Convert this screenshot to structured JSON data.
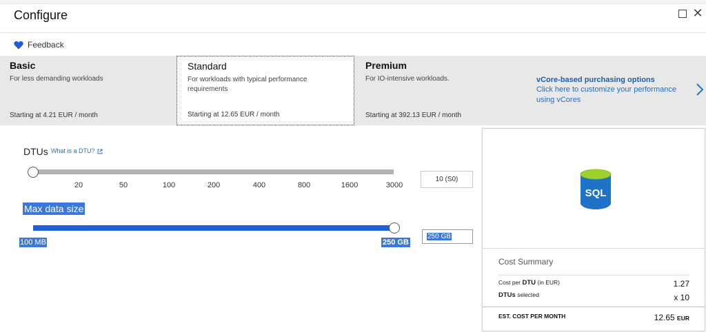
{
  "window": {
    "title": "Configure"
  },
  "feedback": {
    "label": "Feedback"
  },
  "tiers": [
    {
      "name": "Basic",
      "description": "For less demanding workloads",
      "price": "Starting at 4.21 EUR / month"
    },
    {
      "name": "Standard",
      "description": "For workloads with typical performance requirements",
      "price": "Starting at 12.65 EUR / month"
    },
    {
      "name": "Premium",
      "description": "For IO-intensive workloads.",
      "price": "Starting at 392.13 EUR / month"
    }
  ],
  "selected_tier": "Standard",
  "vcore": {
    "title": "vCore-based purchasing options",
    "description": "Click here to customize your performance using vCores"
  },
  "dtu": {
    "label": "DTUs",
    "help_link": "What is a DTU?",
    "ticks": [
      "20",
      "50",
      "100",
      "200",
      "400",
      "800",
      "1600",
      "3000"
    ],
    "value_text": "10 (S0)",
    "slider_fraction": 0
  },
  "max_size": {
    "label": "Max data size",
    "min_label": "100 MB",
    "max_label": "250 GB",
    "value_text": "250 GB",
    "slider_fraction": 1
  },
  "cost": {
    "title": "Cost Summary",
    "cost_per_dtu_label": "Cost per",
    "cost_per_dtu_bold": "DTU",
    "cost_per_dtu_unit": "(in EUR)",
    "cost_per_dtu_value": "1.27",
    "dtus_selected_bold": "DTUs",
    "dtus_selected_label": "selected",
    "dtus_selected_value": "x 10",
    "total_label": "EST. COST PER MONTH",
    "total_value": "12.65",
    "total_currency": "EUR"
  },
  "colors": {
    "accent_blue": "#1f5fd6",
    "link_blue": "#1f6fc5",
    "selection_blue": "#3a78d9",
    "sql_cylinder": "#1e73c9",
    "sql_top": "#9bd22b"
  },
  "icons": {
    "feedback": "heart-icon",
    "maximize": "maximize-icon",
    "close": "close-icon",
    "next": "chevron-right-icon",
    "external": "external-link-icon",
    "database": "sql-database-icon"
  }
}
